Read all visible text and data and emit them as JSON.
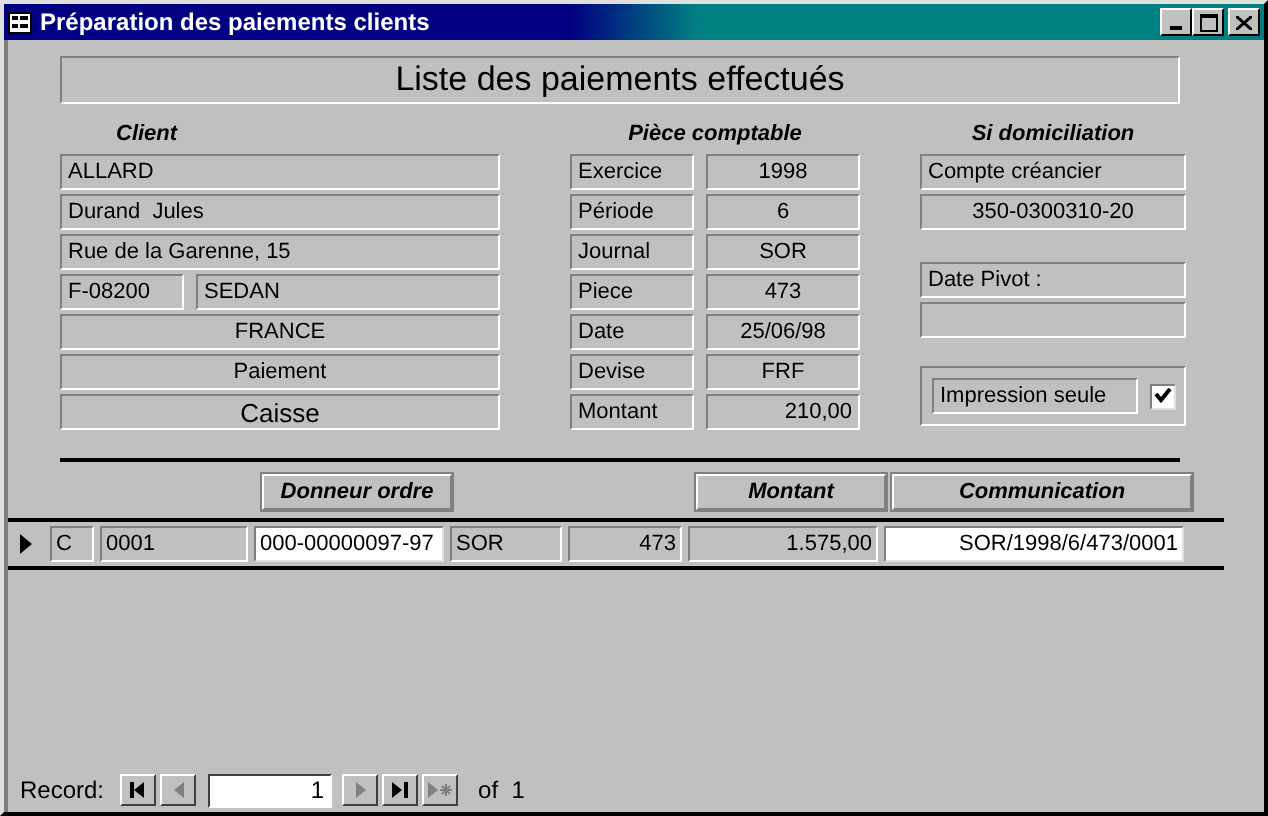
{
  "window": {
    "title": "Préparation des paiements clients"
  },
  "header": {
    "title": "Liste des paiements effectués"
  },
  "client": {
    "heading": "Client",
    "name": "ALLARD",
    "contact": "Durand  Jules",
    "street": "Rue de la Garenne, 15",
    "postcode": "F-08200",
    "city": "SEDAN",
    "country": "FRANCE",
    "payment_type": "Paiement",
    "mode": "Caisse"
  },
  "piece": {
    "heading": "Pièce comptable",
    "rows": [
      {
        "label": "Exercice",
        "value": "1998"
      },
      {
        "label": "Période",
        "value": "6"
      },
      {
        "label": "Journal",
        "value": "SOR"
      },
      {
        "label": "Piece",
        "value": "473"
      },
      {
        "label": "Date",
        "value": "25/06/98"
      },
      {
        "label": "Devise",
        "value": "FRF"
      },
      {
        "label": "Montant",
        "value": "210,00",
        "kind": "amount"
      }
    ]
  },
  "domiciliation": {
    "heading": "Si domiciliation",
    "account_label": "Compte créancier",
    "account": "350-0300310-20",
    "date_pivot_label": "Date Pivot :",
    "print_only": {
      "label": "Impression seule",
      "checked": true
    }
  },
  "table": {
    "headers": {
      "donneur_ordre": "Donneur ordre",
      "montant": "Montant",
      "communication": "Communication"
    },
    "rows": [
      {
        "selected": true,
        "cells": [
          {
            "kind": "text",
            "value": "C"
          },
          {
            "kind": "text",
            "value": "0001"
          },
          {
            "kind": "input",
            "value": "000-00000097-97"
          },
          {
            "kind": "text",
            "value": "SOR"
          },
          {
            "kind": "number",
            "value": "473"
          },
          {
            "kind": "number",
            "value": "1.575,00"
          },
          {
            "kind": "inputright",
            "value": "SOR/1998/6/473/0001"
          }
        ]
      }
    ]
  },
  "navigator": {
    "label": "Record:",
    "current": "1",
    "total": "of  1",
    "buttons": [
      {
        "kind": "first",
        "disabled": false
      },
      {
        "kind": "prev",
        "disabled": true
      },
      {
        "kind": "next",
        "disabled": true
      },
      {
        "kind": "last",
        "disabled": false
      },
      {
        "kind": "new",
        "disabled": true
      }
    ]
  }
}
